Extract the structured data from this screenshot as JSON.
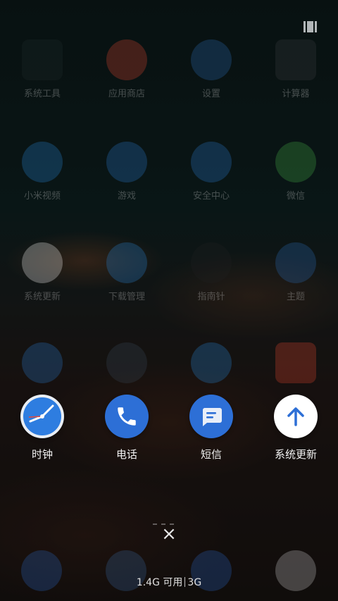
{
  "background_apps": [
    {
      "label": "系统工具",
      "icon": "folder-grid-icon",
      "color": "#222c2c"
    },
    {
      "label": "应用商店",
      "icon": "mi-store-icon",
      "color": "#e3472f"
    },
    {
      "label": "设置",
      "icon": "gear-icon",
      "color": "#2b6cb7"
    },
    {
      "label": "计算器",
      "icon": "calculator-icon",
      "color": "#3e3f42"
    },
    {
      "label": "小米视频",
      "icon": "play-icon",
      "color": "#2a86d6"
    },
    {
      "label": "游戏",
      "icon": "gamepad-icon",
      "color": "#2b7bd0"
    },
    {
      "label": "安全中心",
      "icon": "shield-icon",
      "color": "#2b7bd0"
    },
    {
      "label": "微信",
      "icon": "wechat-icon",
      "color": "#4ab34a"
    },
    {
      "label": "系统更新",
      "icon": "arrow-up-icon",
      "color": "#ffffff"
    },
    {
      "label": "下载管理",
      "icon": "download-icon",
      "color": "#2a86d6"
    },
    {
      "label": "指南针",
      "icon": "compass-icon",
      "color": "#222222"
    },
    {
      "label": "主题",
      "icon": "theme-icon",
      "color": "#2b6cb7"
    },
    {
      "label": "",
      "icon": "folder-icon",
      "color": "#2b7bd0"
    },
    {
      "label": "",
      "icon": "video-icon",
      "color": "#3a4a5a"
    },
    {
      "label": "",
      "icon": "clock-icon",
      "color": "#2a86d6"
    },
    {
      "label": "",
      "icon": "calendar-icon",
      "color": "#e3472f"
    }
  ],
  "recent_apps": [
    {
      "label": "时钟",
      "icon": "clock-icon",
      "color": "#2e7de0"
    },
    {
      "label": "电话",
      "icon": "phone-icon",
      "color": "#2d6fd6"
    },
    {
      "label": "短信",
      "icon": "message-icon",
      "color": "#2d6fd6"
    },
    {
      "label": "系统更新",
      "icon": "arrow-up-icon",
      "color": "#ffffff"
    }
  ],
  "close_label": "×",
  "memory": {
    "available": "1.4G 可用",
    "network": "3G"
  }
}
